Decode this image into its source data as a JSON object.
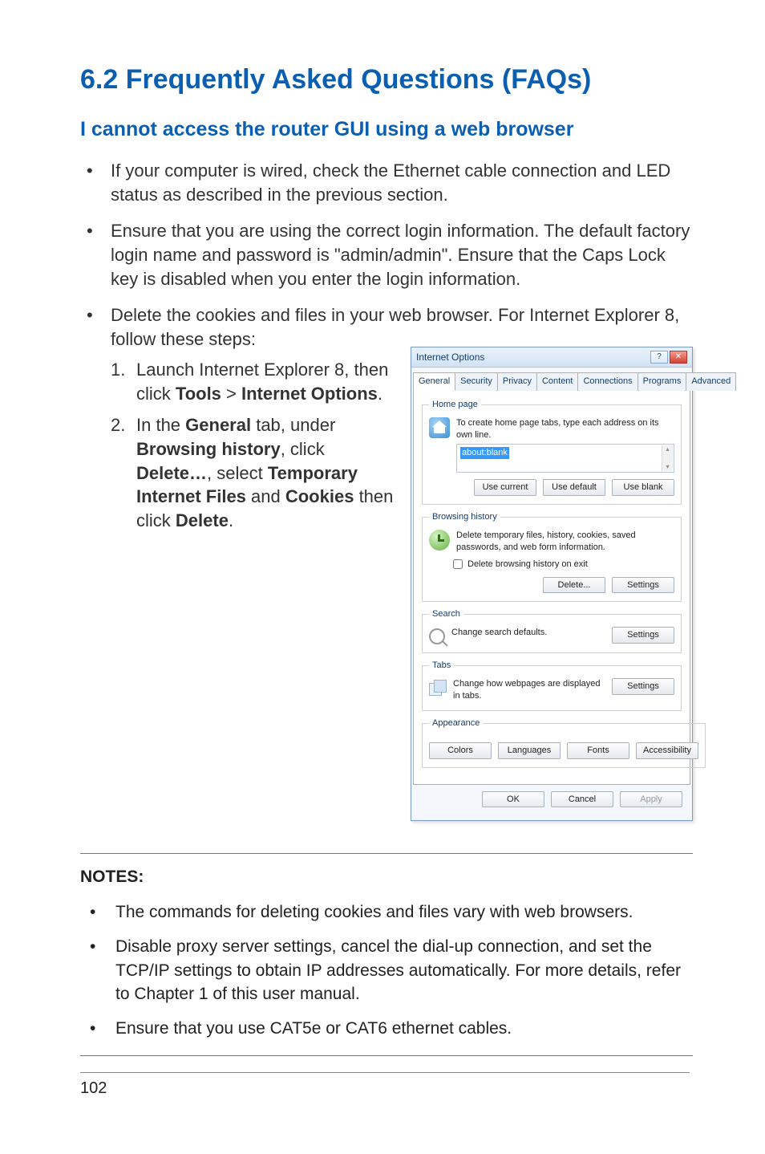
{
  "heading": "6.2   Frequently Asked Questions (FAQs)",
  "subheading": "I cannot access the router GUI using a web browser",
  "bullets": {
    "b1": "If your computer is wired, check the Ethernet cable connection and LED status as described in the previous section.",
    "b2": "Ensure that you are using the correct login information. The default factory login name and password is \"admin/admin\". Ensure that the Caps Lock key is disabled when you enter the login information.",
    "b3": "Delete the cookies and files in your web browser. For Internet Explorer 8, follow these steps:"
  },
  "steps": {
    "s1_pre": "Launch Internet Explorer 8, then click ",
    "s1_tools": "Tools",
    "s1_gt": " > ",
    "s1_io": "Internet Options",
    "s1_post": ".",
    "s2_pre": "In the ",
    "s2_general": "General",
    "s2_mid1": " tab, under ",
    "s2_bh": "Browsing history",
    "s2_mid2": ", click ",
    "s2_del": "Delete…",
    "s2_mid3": ", select ",
    "s2_tif": "Temporary Internet Files",
    "s2_and": " and ",
    "s2_cook": "Cookies",
    "s2_mid4": " then click ",
    "s2_del2": "Delete",
    "s2_post": "."
  },
  "notes": {
    "label": "NOTES:",
    "n1": "The commands for deleting cookies and files vary with web browsers.",
    "n2": "Disable proxy server settings, cancel the dial-up connection, and set the TCP/IP settings to obtain IP addresses automatically. For more details, refer to Chapter 1 of this user manual.",
    "n3": "Ensure that you use CAT5e or CAT6 ethernet cables."
  },
  "page_number": "102",
  "dialog": {
    "title": "Internet Options",
    "help_btn": "?",
    "close_btn": "✕",
    "tabs": [
      "General",
      "Security",
      "Privacy",
      "Content",
      "Connections",
      "Programs",
      "Advanced"
    ],
    "homepage": {
      "legend": "Home page",
      "text": "To create home page tabs, type each address on its own line.",
      "url": "about:blank",
      "use_current": "Use current",
      "use_default": "Use default",
      "use_blank": "Use blank"
    },
    "history": {
      "legend": "Browsing history",
      "text": "Delete temporary files, history, cookies, saved passwords, and web form information.",
      "chk": "Delete browsing history on exit",
      "delete": "Delete...",
      "settings": "Settings"
    },
    "search": {
      "legend": "Search",
      "text": "Change search defaults.",
      "settings": "Settings"
    },
    "tabs_group": {
      "legend": "Tabs",
      "text": "Change how webpages are displayed in tabs.",
      "settings": "Settings"
    },
    "appearance": {
      "legend": "Appearance",
      "colors": "Colors",
      "languages": "Languages",
      "fonts": "Fonts",
      "accessibility": "Accessibility"
    },
    "footer": {
      "ok": "OK",
      "cancel": "Cancel",
      "apply": "Apply"
    }
  }
}
